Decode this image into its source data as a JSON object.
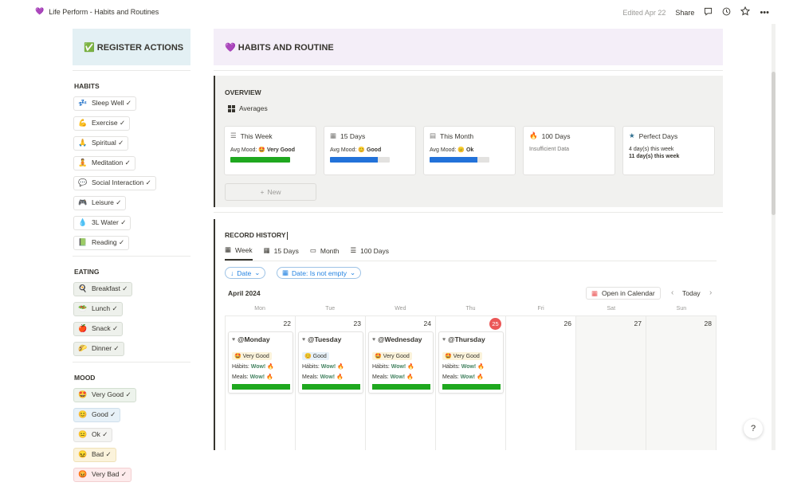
{
  "topbar": {
    "page_icon": "💜",
    "title": "Life Perform - Habits and Routines",
    "edited": "Edited Apr 22",
    "share": "Share"
  },
  "left": {
    "header": "✅ REGISTER ACTIONS",
    "habits_title": "HABITS",
    "habits": [
      {
        "icon": "💤",
        "label": "Sleep Well ✓"
      },
      {
        "icon": "💪",
        "label": "Exercise ✓"
      },
      {
        "icon": "🙏",
        "label": "Spiritual ✓"
      },
      {
        "icon": "🧘",
        "label": "Meditation ✓"
      },
      {
        "icon": "💬",
        "label": "Social Interaction ✓"
      },
      {
        "icon": "🎮",
        "label": "Leisure ✓"
      },
      {
        "icon": "💧",
        "label": "3L Water ✓"
      },
      {
        "icon": "📗",
        "label": "Reading ✓"
      }
    ],
    "eating_title": "EATING",
    "eating": [
      {
        "icon": "🍳",
        "label": "Breakfast ✓"
      },
      {
        "icon": "🥗",
        "label": "Lunch ✓"
      },
      {
        "icon": "🍎",
        "label": "Snack ✓"
      },
      {
        "icon": "🌮",
        "label": "Dinner ✓"
      }
    ],
    "mood_title": "MOOD",
    "moods": [
      {
        "icon": "🤩",
        "label": "Very Good ✓"
      },
      {
        "icon": "😊",
        "label": "Good ✓"
      },
      {
        "icon": "😐",
        "label": "Ok ✓"
      },
      {
        "icon": "😖",
        "label": "Bad ✓"
      },
      {
        "icon": "😡",
        "label": "Very Bad ✓"
      }
    ]
  },
  "right": {
    "header": "💜 HABITS AND ROUTINE",
    "overview_title": "OVERVIEW",
    "overview_view": "Averages",
    "cards": [
      {
        "title": "This Week",
        "mood_label": "Avg Mood: ",
        "mood_icon": "🤩",
        "mood_value": "Very Good",
        "bar_fill": 1.0,
        "bar_color": "#1fa81f"
      },
      {
        "title": "15 Days",
        "mood_label": "Avg Mood: ",
        "mood_icon": "😊",
        "mood_value": "Good",
        "bar_fill": 0.8,
        "bar_color": "#2272d9"
      },
      {
        "title": "This Month",
        "mood_label": "Avg Mood: ",
        "mood_icon": "😐",
        "mood_value": "Ok",
        "bar_fill": 0.8,
        "bar_color": "#2272d9"
      },
      {
        "title": "100 Days",
        "note": "Insufficient Data"
      },
      {
        "title": "Perfect Days",
        "line1": "4 day(s) this week",
        "line2": "11 day(s) this week"
      }
    ],
    "new_label": "New",
    "history_title": "RECORD HISTORY",
    "tabs": [
      "Week",
      "15 Days",
      "Month",
      "100 Days"
    ],
    "filters": {
      "sort": "Date",
      "date_filter": "Date: Is not empty"
    },
    "month_label": "April 2024",
    "open_calendar": "Open in Calendar",
    "today": "Today",
    "days_of_week": [
      "Mon",
      "Tue",
      "Wed",
      "Thu",
      "Fri",
      "Sat",
      "Sun"
    ],
    "day_numbers": [
      "22",
      "23",
      "24",
      "25",
      "26",
      "27",
      "28"
    ],
    "entries": [
      {
        "title": "@Monday",
        "mood_icon": "🤩",
        "mood": "Very Good",
        "mood_bg": "#fbf3db",
        "habits_label": "Hábits: ",
        "habits_value": "Wow! 🔥",
        "meals_label": "Meals: ",
        "meals_value": "Wow! 🔥"
      },
      {
        "title": "@Tuesday",
        "mood_icon": "😊",
        "mood": "Good",
        "mood_bg": "#e7f1f8",
        "habits_label": "Hábits: ",
        "habits_value": "Wow! 🔥",
        "meals_label": "Meals: ",
        "meals_value": "Wow! 🔥"
      },
      {
        "title": "@Wednesday",
        "mood_icon": "🤩",
        "mood": "Very Good",
        "mood_bg": "#fbf3db",
        "habits_label": "Hábits: ",
        "habits_value": "Wow! 🔥",
        "meals_label": "Meals: ",
        "meals_value": "Wow! 🔥"
      },
      {
        "title": "@Thursday",
        "mood_icon": "🤩",
        "mood": "Very Good",
        "mood_bg": "#fbf3db",
        "habits_label": "Hábits: ",
        "habits_value": "Wow! 🔥",
        "meals_label": "Meals: ",
        "meals_value": "Wow! 🔥"
      }
    ],
    "help": "?"
  }
}
